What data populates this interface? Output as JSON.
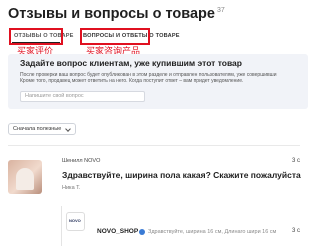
{
  "header": {
    "title": "Отзывы и вопросы о товаре",
    "count": "37"
  },
  "tabs": [
    {
      "label": "ОТЗЫВЫ О ТОВАРЕ",
      "annotation": "买家评价"
    },
    {
      "label": "ВОПРОСЫ И ОТВЕТЫ О ТОВАРЕ",
      "annotation": "买家咨询产品"
    }
  ],
  "annotations": {
    "color": "#e01020"
  },
  "ask": {
    "heading": "Задайте вопрос клиентам, уже купившим этот товар",
    "description_line1": "После проверки ваш вопрос будет опубликован в этом разделе и отправлен пользователям, уже совершивши",
    "description_line2": "Кроме того, продавец может ответить на него. Когда поступит ответ – вам придет уведомление.",
    "input_placeholder": "Напишите свой вопрос"
  },
  "sort": {
    "selected": "Сначала полезные"
  },
  "question": {
    "brand": "Шенилл NOVO",
    "text": "Здравствуйте, ширина пола какая? Скажите пожалуйста",
    "author": "Ника Т.",
    "date": "3 с"
  },
  "answer": {
    "avatar_text": "NOVO",
    "shop": "NOVO_SHOP",
    "snippet": "Здравствуйте, ширина 16 см, Длинаго шири 16 см",
    "date": "3 с",
    "verified_color": "#3a7bd5"
  }
}
